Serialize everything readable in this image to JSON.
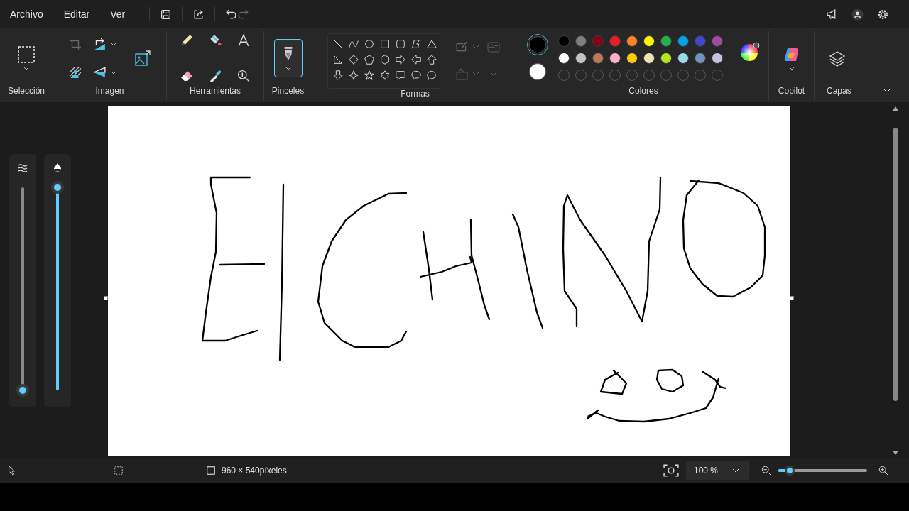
{
  "menu": [
    "Archivo",
    "Editar",
    "Ver"
  ],
  "quick_actions": [
    {
      "kind": "save",
      "disabled": false
    },
    {
      "kind": "share",
      "disabled": false
    },
    {
      "kind": "undo",
      "disabled": false
    },
    {
      "kind": "redo",
      "disabled": true
    }
  ],
  "ribbon": {
    "groups": [
      "Selección",
      "Imagen",
      "Herramientas",
      "Pinceles",
      "Formas",
      "Colores",
      "Copilot",
      "Capas"
    ],
    "brush_button": {
      "selected": true
    }
  },
  "colors": {
    "primary": {
      "color": "#000000",
      "selected": true
    },
    "secondary": {
      "color": "#ffffff",
      "selected": false
    },
    "palette": [
      {
        "color": "#000000"
      },
      {
        "color": "#7f7f7f"
      },
      {
        "color": "#880015"
      },
      {
        "color": "#ed1c24"
      },
      {
        "color": "#ff7f27"
      },
      {
        "color": "#fff200"
      },
      {
        "color": "#22b14c"
      },
      {
        "color": "#00a2e8"
      },
      {
        "color": "#3f48cc"
      },
      {
        "color": "#a349a4"
      },
      {
        "color": "#ffffff"
      },
      {
        "color": "#c3c3c3"
      },
      {
        "color": "#b97a57"
      },
      {
        "color": "#ffaec9"
      },
      {
        "color": "#ffc90e"
      },
      {
        "color": "#efe4b0"
      },
      {
        "color": "#b5e61d"
      },
      {
        "color": "#99d9ea"
      },
      {
        "color": "#7092be"
      },
      {
        "color": "#c8bfe7"
      }
    ]
  },
  "side_sliders": [
    {
      "kind": "size",
      "level": 0
    },
    {
      "kind": "opacity",
      "level": 1
    }
  ],
  "status_bar": {
    "canvas_size": "960 × 540píxeles",
    "zoom": "100 %",
    "zoom_slider": {
      "level": 0.13
    }
  }
}
